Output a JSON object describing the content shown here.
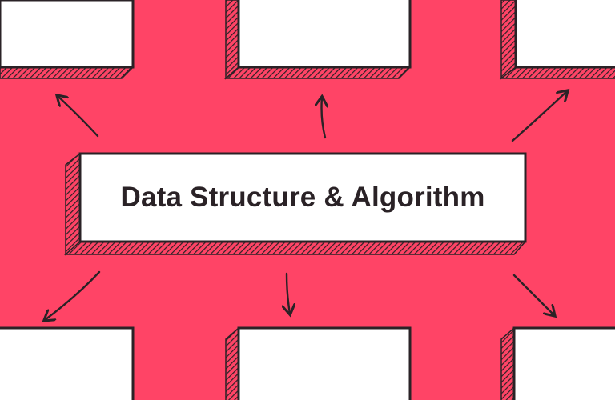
{
  "title": "Data Structure & Algorithm",
  "colors": {
    "background": "#ff4466",
    "card": "#ffffff",
    "ink": "#2a2226"
  }
}
